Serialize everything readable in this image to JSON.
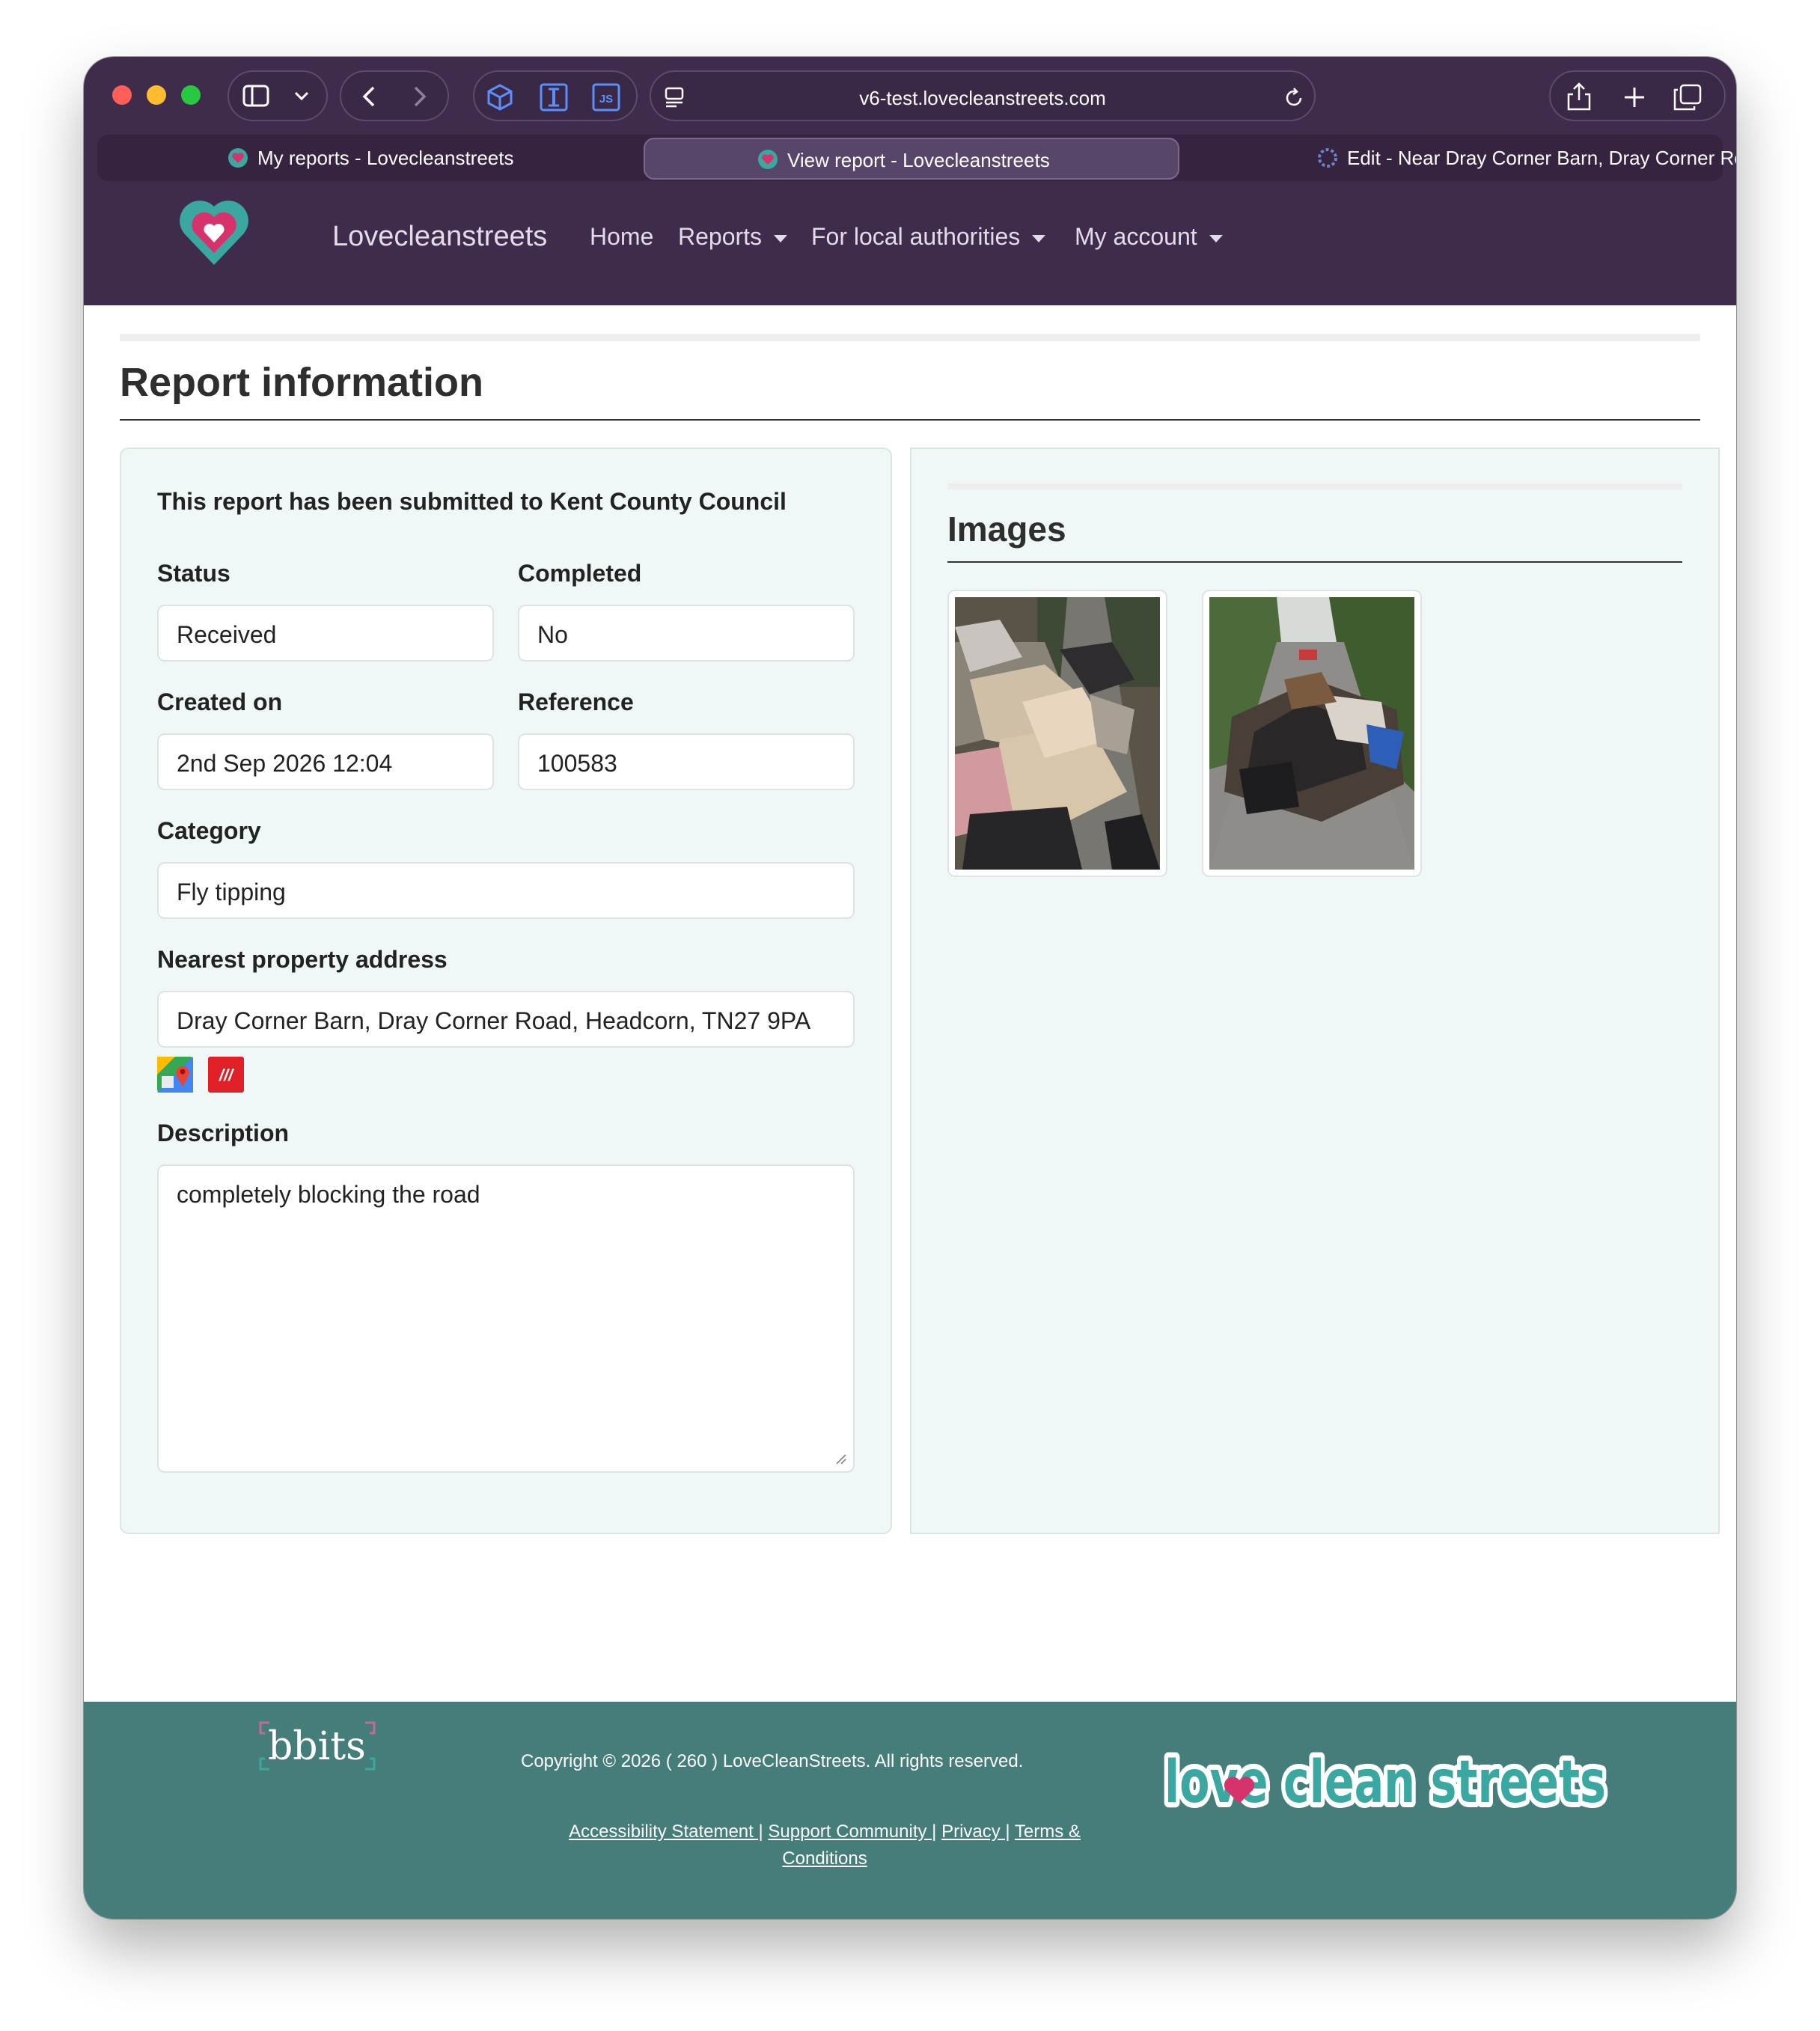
{
  "browser": {
    "url": "v6-test.lovecleanstreets.com",
    "tabs": [
      {
        "label": "My reports - Lovecleanstreets",
        "active": false
      },
      {
        "label": "View report - Lovecleanstreets",
        "active": true
      },
      {
        "label": "Edit - Near Dray Corner Barn, Dray Corner Road,...",
        "active": false
      }
    ],
    "icons": [
      "sidebar-icon",
      "chevron-down-icon",
      "back-icon",
      "forward-icon",
      "cube-extension-icon",
      "text-cursor-extension-icon",
      "js-extension-icon",
      "page-menu-icon",
      "reload-icon",
      "share-icon",
      "new-tab-icon",
      "tab-overview-icon"
    ]
  },
  "nav": {
    "brand": "Lovecleanstreets",
    "items": [
      {
        "label": "Home",
        "dropdown": false
      },
      {
        "label": "Reports",
        "dropdown": true
      },
      {
        "label": "For local authorities",
        "dropdown": true
      },
      {
        "label": "My account",
        "dropdown": true
      }
    ]
  },
  "page": {
    "title": "Report information",
    "submitted_to": "This report has been submitted to Kent County Council",
    "fields": {
      "status": {
        "label": "Status",
        "value": "Received"
      },
      "completed": {
        "label": "Completed",
        "value": "No"
      },
      "created_on": {
        "label": "Created on",
        "value": "2nd Sep 2026 12:04"
      },
      "reference": {
        "label": "Reference",
        "value": "100583"
      },
      "category": {
        "label": "Category",
        "value": "Fly tipping"
      },
      "address": {
        "label": "Nearest property address",
        "value": "Dray Corner Barn, Dray Corner Road, Headcorn, TN27 9PA"
      },
      "description": {
        "label": "Description",
        "value": "completely blocking the road"
      }
    },
    "images_heading": "Images",
    "images": [
      {
        "name": "report-photo-1",
        "alt_subject": "fly-tipped rubble and boards on lane"
      },
      {
        "name": "report-photo-2",
        "alt_subject": "pile of dumped waste across road"
      }
    ]
  },
  "footer": {
    "partner_logo": "bbits",
    "copyright": "Copyright © 2026 ( 260 ) LoveCleanStreets. All rights reserved.",
    "links": [
      "Accessibility Statement |",
      "Support Community |",
      "Privacy |",
      "Terms & Conditions"
    ],
    "logo_text": "love clean streets"
  },
  "colors": {
    "chrome": "#3f2b4c",
    "card_bg": "#f0f8f7",
    "footer": "#457d7a",
    "brand_pink": "#d6336c",
    "brand_teal": "#3aa8a0"
  }
}
